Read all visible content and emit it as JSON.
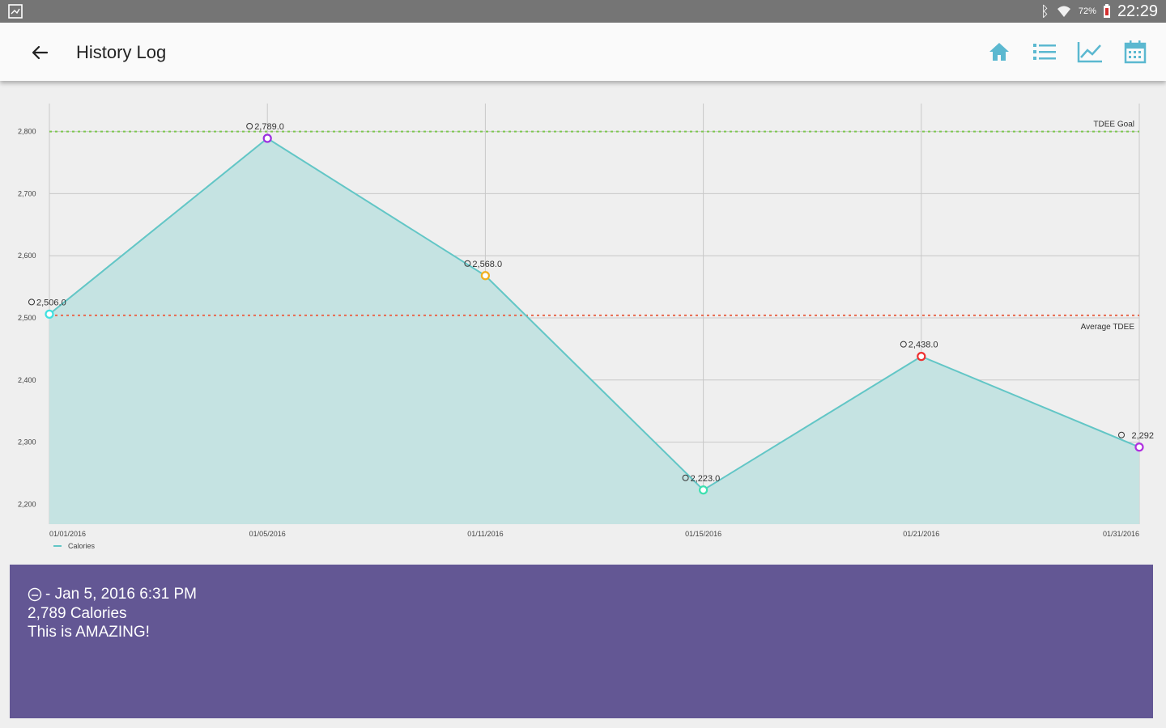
{
  "status_bar": {
    "battery": "72%",
    "time": "22:29"
  },
  "app_bar": {
    "title": "History Log"
  },
  "actions": [
    {
      "name": "home",
      "icon": "home-icon"
    },
    {
      "name": "list",
      "icon": "list-icon"
    },
    {
      "name": "chart",
      "icon": "trend-chart-icon"
    },
    {
      "name": "calendar",
      "icon": "calendar-icon"
    }
  ],
  "colors": {
    "accent": "#5bb8d0",
    "line": "#62c6c6",
    "fill": "#c5e3e2",
    "goal": "#7ec84f",
    "average": "#e8694f",
    "panel": "#635794"
  },
  "chart_data": {
    "type": "area",
    "x": [
      "01/01/2016",
      "01/05/2016",
      "01/11/2016",
      "01/15/2016",
      "01/21/2016",
      "01/31/2016"
    ],
    "series": [
      {
        "name": "Calories",
        "values": [
          2506.0,
          2789.0,
          2568.0,
          2223.0,
          2438.0,
          2292.0
        ],
        "point_labels": [
          "2,506.0",
          "2,789.0",
          "2,568.0",
          "2,223.0",
          "2,438.0",
          "2,292"
        ],
        "marker_colors": [
          "#3ee0e0",
          "#9b30e0",
          "#f0b020",
          "#3ee0b0",
          "#ee3030",
          "#b030e0"
        ]
      }
    ],
    "y_ticks": [
      "2,200",
      "2,300",
      "2,400",
      "2,500",
      "2,600",
      "2,700",
      "2,800"
    ],
    "ylim": [
      2168,
      2845
    ],
    "reference_lines": [
      {
        "label": "TDEE Goal",
        "value": 2800,
        "color": "#7ec84f"
      }
    ],
    "average_line": {
      "label": "Average TDEE",
      "value": 2504,
      "color": "#e8694f"
    },
    "legend": {
      "label": "Calories",
      "position": "bottom-left"
    },
    "grid": true
  },
  "info_panel": {
    "line1": "- Jan 5, 2016 6:31 PM",
    "line2": "2,789 Calories",
    "line3": "This is AMAZING!"
  }
}
